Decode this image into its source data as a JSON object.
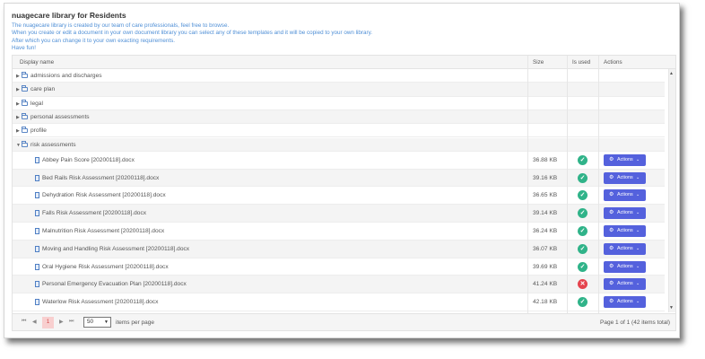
{
  "title": "nuagecare library for Residents",
  "intro": [
    "The nuagecare library is created by our team of care professionals, feel free to browse.",
    "When you create or edit a document in your own document library you can select any of these templates and it will be copied to your own library.",
    "After which you can change it to your own exacting requirements.",
    "Have fun!"
  ],
  "columns": {
    "name": "Display name",
    "size": "Size",
    "used": "Is used",
    "actions": "Actions"
  },
  "folders": [
    {
      "name": "admissions and discharges",
      "expanded": false
    },
    {
      "name": "care plan",
      "expanded": false
    },
    {
      "name": "legal",
      "expanded": false
    },
    {
      "name": "personal assessments",
      "expanded": false
    },
    {
      "name": "profile",
      "expanded": false
    },
    {
      "name": "risk assessments",
      "expanded": true
    }
  ],
  "files": [
    {
      "name": "Abbey Pain Score [20200118].docx",
      "size": "36.88 KB",
      "used": true
    },
    {
      "name": "Bed Rails Risk Assessment [20200118].docx",
      "size": "39.16 KB",
      "used": true
    },
    {
      "name": "Dehydration Risk Assessment [20200118].docx",
      "size": "36.65 KB",
      "used": true
    },
    {
      "name": "Falls Risk Assessment [20200118].docx",
      "size": "39.14 KB",
      "used": true
    },
    {
      "name": "Malnutrition Risk Assessment [20200118].docx",
      "size": "36.24 KB",
      "used": true
    },
    {
      "name": "Moving and Handling Risk Assessment [20200118].docx",
      "size": "36.07 KB",
      "used": true
    },
    {
      "name": "Oral Hygiene Risk Assessment [20200118].docx",
      "size": "39.69 KB",
      "used": true
    },
    {
      "name": "Personal Emergency Evacuation Plan [20200118].docx",
      "size": "41.24 KB",
      "used": false
    },
    {
      "name": "Waterlow Risk Assessment [20200118].docx",
      "size": "42.18 KB",
      "used": true
    }
  ],
  "actions_label": "Actions",
  "pager": {
    "current_page": "1",
    "page_size": "50",
    "items_per_page_label": "items per page",
    "info": "Page 1 of 1 (42 items total)"
  },
  "colors": {
    "accent": "#5461dd",
    "used_ok": "#30b389",
    "used_no": "#e5434d",
    "intro_text": "#4f8fd6"
  },
  "icons": {
    "folder": "folder-icon",
    "file": "document-icon",
    "used_ok": "check-circle-icon",
    "used_no": "x-circle-icon",
    "gear": "gear-icon"
  }
}
